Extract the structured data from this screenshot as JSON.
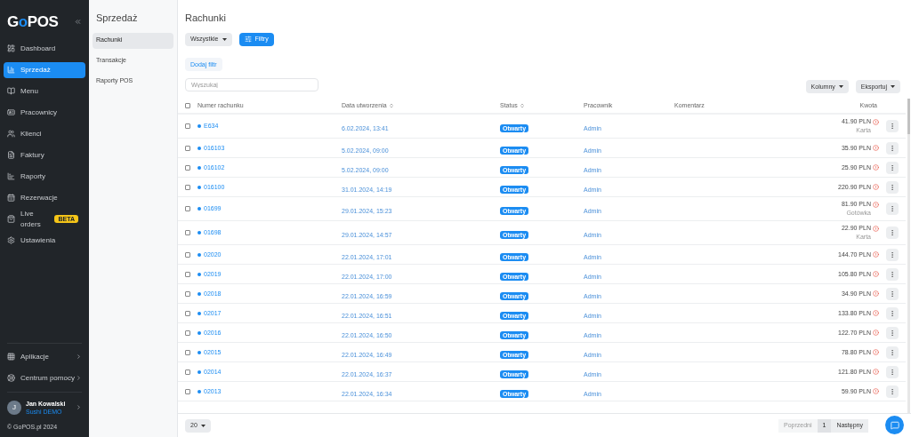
{
  "sidebar": {
    "logo": [
      "G",
      "o",
      "POS"
    ],
    "items": [
      {
        "label": "Dashboard",
        "selected": false
      },
      {
        "label": "Sprzedaż",
        "selected": true
      },
      {
        "label": "Menu",
        "selected": false
      },
      {
        "label": "Pracownicy",
        "selected": false
      },
      {
        "label": "Klienci",
        "selected": false
      },
      {
        "label": "Faktury",
        "selected": false
      },
      {
        "label": "Raporty",
        "selected": false
      },
      {
        "label": "Rezerwacje",
        "selected": false
      },
      {
        "label": "Live orders",
        "selected": false,
        "badge": "BETA"
      },
      {
        "label": "Ustawienia",
        "selected": false
      }
    ],
    "bottom_items": [
      {
        "label": "Aplikacje"
      },
      {
        "label": "Centrum pomocy"
      }
    ],
    "user": {
      "initial": "J",
      "name": "Jan Kowalski",
      "venue": "Sushi DEMO"
    },
    "footer": "© GoPOS.pl 2024"
  },
  "subnav": {
    "title": "Sprzedaż",
    "items": [
      {
        "label": "Rachunki",
        "selected": true
      },
      {
        "label": "Transakcje",
        "selected": false
      },
      {
        "label": "Raporty POS",
        "selected": false
      }
    ]
  },
  "page": {
    "title": "Rachunki",
    "filter_dropdown": "Wszystkie",
    "filters_button": "Filtry",
    "add_filter": "Dodaj filtr",
    "search": {
      "placeholder": "Wyszukaj"
    },
    "columns_button": "Kolumny",
    "export_button": "Eksportuj"
  },
  "table": {
    "select_all_checked": false,
    "columns": [
      {
        "label": "Numer rachunku",
        "sortable": false
      },
      {
        "label": "Data utworzenia",
        "sortable": true
      },
      {
        "label": "Status",
        "sortable": true
      },
      {
        "label": "Pracownik",
        "sortable": false
      },
      {
        "label": "Komentarz",
        "sortable": false
      },
      {
        "label": "Kwota",
        "sortable": false
      }
    ],
    "rows": [
      {
        "number": "E634",
        "date": "6.02.2024, 13:41",
        "status": "Otwarty",
        "employee": "Admin",
        "amount": "41.90 PLN",
        "payment": "Karta",
        "checked": false
      },
      {
        "number": "016103",
        "date": "5.02.2024, 09:00",
        "status": "Otwarty",
        "employee": "Admin",
        "amount": "35.90 PLN",
        "checked": false
      },
      {
        "number": "016102",
        "date": "5.02.2024, 09:00",
        "status": "Otwarty",
        "employee": "Admin",
        "amount": "25.90 PLN",
        "checked": false
      },
      {
        "number": "016100",
        "date": "31.01.2024, 14:19",
        "status": "Otwarty",
        "employee": "Admin",
        "amount": "220.90 PLN",
        "checked": false
      },
      {
        "number": "01699",
        "date": "29.01.2024, 15:23",
        "status": "Otwarty",
        "employee": "Admin",
        "amount": "81.90 PLN",
        "payment": "Gotówka",
        "checked": false
      },
      {
        "number": "01698",
        "date": "29.01.2024, 14:57",
        "status": "Otwarty",
        "employee": "Admin",
        "amount": "22.90 PLN",
        "payment": "Karta",
        "checked": false
      },
      {
        "number": "02020",
        "date": "22.01.2024, 17:01",
        "status": "Otwarty",
        "employee": "Admin",
        "amount": "144.70 PLN",
        "checked": false
      },
      {
        "number": "02019",
        "date": "22.01.2024, 17:00",
        "status": "Otwarty",
        "employee": "Admin",
        "amount": "105.80 PLN",
        "checked": false
      },
      {
        "number": "02018",
        "date": "22.01.2024, 16:59",
        "status": "Otwarty",
        "employee": "Admin",
        "amount": "34.90 PLN",
        "checked": false
      },
      {
        "number": "02017",
        "date": "22.01.2024, 16:51",
        "status": "Otwarty",
        "employee": "Admin",
        "amount": "133.80 PLN",
        "checked": false
      },
      {
        "number": "02016",
        "date": "22.01.2024, 16:50",
        "status": "Otwarty",
        "employee": "Admin",
        "amount": "122.70 PLN",
        "checked": false
      },
      {
        "number": "02015",
        "date": "22.01.2024, 16:49",
        "status": "Otwarty",
        "employee": "Admin",
        "amount": "78.80 PLN",
        "checked": false
      },
      {
        "number": "02014",
        "date": "22.01.2024, 16:37",
        "status": "Otwarty",
        "employee": "Admin",
        "amount": "121.80 PLN",
        "checked": false
      },
      {
        "number": "02013",
        "date": "22.01.2024, 16:34",
        "status": "Otwarty",
        "employee": "Admin",
        "amount": "59.90 PLN",
        "checked": false
      }
    ]
  },
  "footer": {
    "page_size": "20",
    "pagination": [
      {
        "label": "Poprzedni",
        "selected": false
      },
      {
        "label": "1",
        "selected": true
      },
      {
        "label": "Następny",
        "selected": false
      }
    ]
  }
}
